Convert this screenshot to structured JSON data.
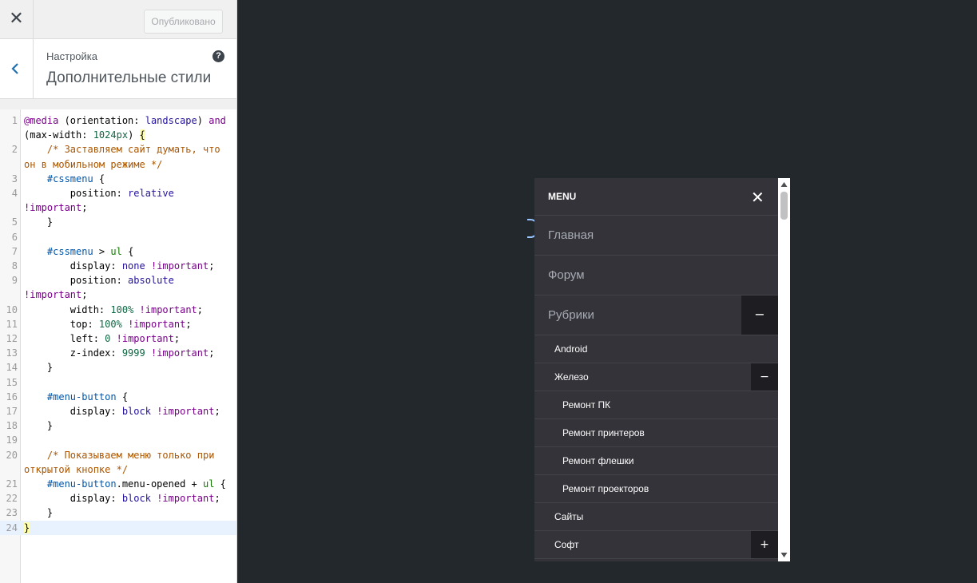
{
  "topbar": {
    "close_glyph": "✕",
    "publish_label": "Опубликовано"
  },
  "section": {
    "label": "Настройка",
    "title": "Дополнительные стили",
    "help_glyph": "?"
  },
  "code_lines": [
    {
      "n": "1",
      "t": "@media (orientation: landscape) and"
    },
    {
      "n": "",
      "t": "(max-width: 1024px) {"
    },
    {
      "n": "2",
      "t": "    /* Заставляем сайт думать, что"
    },
    {
      "n": "",
      "t": "он в мобильном режиме */"
    },
    {
      "n": "3",
      "t": "    #cssmenu {"
    },
    {
      "n": "4",
      "t": "        position: relative"
    },
    {
      "n": "",
      "t": "!important;"
    },
    {
      "n": "5",
      "t": "    }"
    },
    {
      "n": "6",
      "t": ""
    },
    {
      "n": "7",
      "t": "    #cssmenu > ul {"
    },
    {
      "n": "8",
      "t": "        display: none !important;"
    },
    {
      "n": "9",
      "t": "        position: absolute"
    },
    {
      "n": "",
      "t": "!important;"
    },
    {
      "n": "10",
      "t": "        width: 100% !important;"
    },
    {
      "n": "11",
      "t": "        top: 100% !important;"
    },
    {
      "n": "12",
      "t": "        left: 0 !important;"
    },
    {
      "n": "13",
      "t": "        z-index: 9999 !important;"
    },
    {
      "n": "14",
      "t": "    }"
    },
    {
      "n": "15",
      "t": ""
    },
    {
      "n": "16",
      "t": "    #menu-button {"
    },
    {
      "n": "17",
      "t": "        display: block !important;"
    },
    {
      "n": "18",
      "t": "    }"
    },
    {
      "n": "19",
      "t": ""
    },
    {
      "n": "20",
      "t": "    /* Показываем меню только при"
    },
    {
      "n": "",
      "t": "открытой кнопке */"
    },
    {
      "n": "21",
      "t": "    #menu-button.menu-opened + ul {"
    },
    {
      "n": "22",
      "t": "        display: block !important;"
    },
    {
      "n": "23",
      "t": "    }"
    },
    {
      "n": "24",
      "t": "}"
    }
  ],
  "menu": {
    "title": "MENU",
    "close_glyph": "✕",
    "items": [
      {
        "label": "Главная",
        "level": 1
      },
      {
        "label": "Форум",
        "level": 1
      },
      {
        "label": "Рубрики",
        "level": 1,
        "toggle": "−"
      },
      {
        "label": "Android",
        "level": 2
      },
      {
        "label": "Железо",
        "level": 2,
        "toggle": "−"
      },
      {
        "label": "Ремонт ПК",
        "level": 3
      },
      {
        "label": "Ремонт принтеров",
        "level": 3
      },
      {
        "label": "Ремонт флешки",
        "level": 3
      },
      {
        "label": "Ремонт проекторов",
        "level": 3
      },
      {
        "label": "Сайты",
        "level": 2
      },
      {
        "label": "Софт",
        "level": 2,
        "toggle": "+"
      }
    ]
  },
  "colors": {
    "sidebar_bg": "#ffffff",
    "preview_bg": "#23282d",
    "menu_bg": "#333339",
    "toggle_bg": "#1e1e22"
  }
}
